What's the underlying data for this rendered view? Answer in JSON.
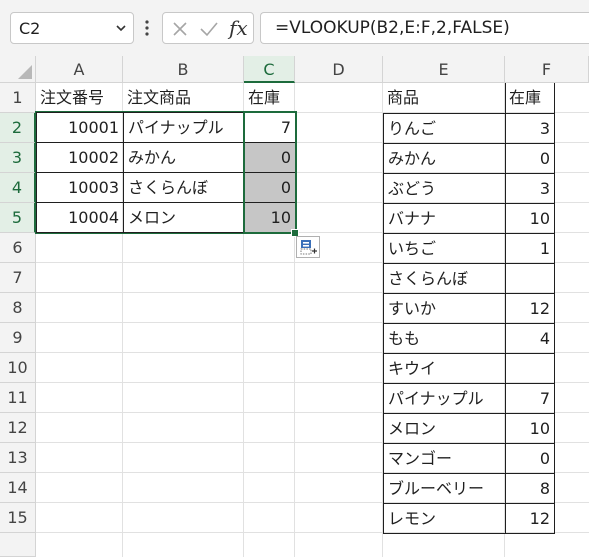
{
  "namebox": {
    "value": "C2"
  },
  "formula_bar": {
    "formula": "=VLOOKUP(B2,E:F,2,FALSE)",
    "fx_label": "fx"
  },
  "columns": [
    "A",
    "B",
    "C",
    "D",
    "E",
    "F"
  ],
  "rows": [
    "1",
    "2",
    "3",
    "4",
    "5",
    "6",
    "7",
    "8",
    "9",
    "10",
    "11",
    "12",
    "13",
    "14",
    "15"
  ],
  "orders": {
    "headers": {
      "a": "注文番号",
      "b": "注文商品",
      "c": "在庫"
    },
    "rows": [
      {
        "a": "10001",
        "b": "パイナップル",
        "c": "7"
      },
      {
        "a": "10002",
        "b": "みかん",
        "c": "0"
      },
      {
        "a": "10003",
        "b": "さくらんぼ",
        "c": "0"
      },
      {
        "a": "10004",
        "b": "メロン",
        "c": "10"
      }
    ]
  },
  "stock": {
    "headers": {
      "e": "商品",
      "f": "在庫"
    },
    "rows": [
      {
        "e": "りんご",
        "f": "3"
      },
      {
        "e": "みかん",
        "f": "0"
      },
      {
        "e": "ぶどう",
        "f": "3"
      },
      {
        "e": "バナナ",
        "f": "10"
      },
      {
        "e": "いちご",
        "f": "1"
      },
      {
        "e": "さくらんぼ",
        "f": ""
      },
      {
        "e": "すいか",
        "f": "12"
      },
      {
        "e": "もも",
        "f": "4"
      },
      {
        "e": "キウイ",
        "f": ""
      },
      {
        "e": "パイナップル",
        "f": "7"
      },
      {
        "e": "メロン",
        "f": "10"
      },
      {
        "e": "マンゴー",
        "f": "0"
      },
      {
        "e": "ブルーベリー",
        "f": "8"
      },
      {
        "e": "レモン",
        "f": "12"
      }
    ]
  },
  "colors": {
    "accent": "#1d6b3c",
    "highlight": "#c6c6c6"
  }
}
